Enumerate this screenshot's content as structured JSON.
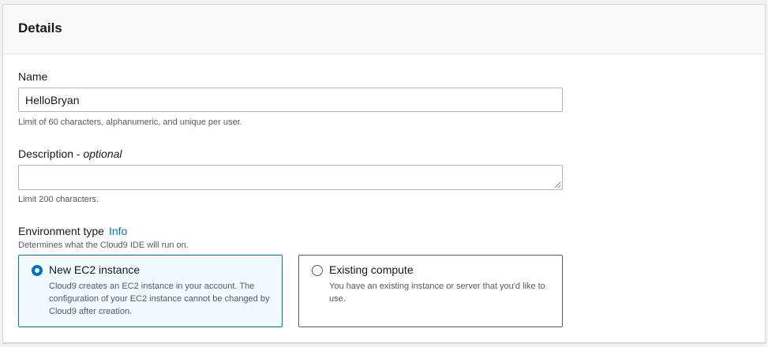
{
  "panel": {
    "title": "Details"
  },
  "name_field": {
    "label": "Name",
    "value": "HelloBryan",
    "hint": "Limit of 60 characters, alphanumeric, and unique per user."
  },
  "description_field": {
    "label": "Description - ",
    "label_optional": "optional",
    "value": "",
    "hint": "Limit 200 characters."
  },
  "environment_type": {
    "label": "Environment type",
    "info_link": "Info",
    "hint": "Determines what the Cloud9 IDE will run on.",
    "selected": "new-ec2",
    "options": [
      {
        "title": "New EC2 instance",
        "description": "Cloud9 creates an EC2 instance in your account. The configuration of your EC2 instance cannot be changed by Cloud9 after creation."
      },
      {
        "title": "Existing compute",
        "description": "You have an existing instance or server that you'd like to use."
      }
    ]
  },
  "colors": {
    "accent": "#0073bb",
    "selected_tile_bg": "#f1faff",
    "text": "#16191f",
    "secondary_text": "#545b64"
  }
}
